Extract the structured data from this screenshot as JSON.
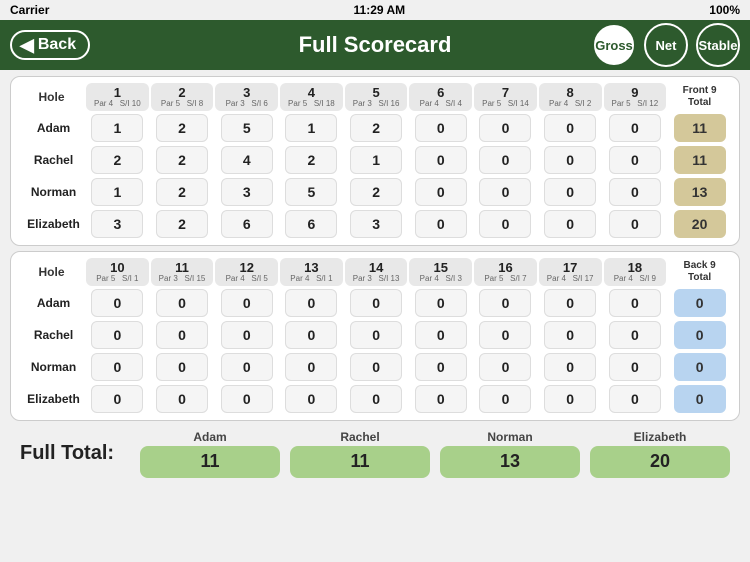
{
  "status_bar": {
    "carrier": "Carrier",
    "time": "11:29 AM",
    "battery": "100%"
  },
  "header": {
    "back_label": "Back",
    "title": "Full Scorecard",
    "modes": [
      {
        "label": "Gross",
        "active": true
      },
      {
        "label": "Net",
        "active": false
      },
      {
        "label": "Stable",
        "active": false
      }
    ]
  },
  "front9": {
    "section_label": "Front 9",
    "holes": [
      {
        "num": "1",
        "par": "4",
        "si": "10"
      },
      {
        "num": "2",
        "par": "5",
        "si": "8"
      },
      {
        "num": "3",
        "par": "3",
        "si": "6"
      },
      {
        "num": "4",
        "par": "5",
        "si": "18"
      },
      {
        "num": "5",
        "par": "3",
        "si": "16"
      },
      {
        "num": "6",
        "par": "4",
        "si": "4"
      },
      {
        "num": "7",
        "par": "5",
        "si": "14"
      },
      {
        "num": "8",
        "par": "4",
        "si": "2"
      },
      {
        "num": "9",
        "par": "5",
        "si": "12"
      }
    ],
    "total_label": "Front 9\nTotal",
    "players": [
      {
        "name": "Adam",
        "scores": [
          "1",
          "2",
          "5",
          "1",
          "2",
          "0",
          "0",
          "0",
          "0"
        ],
        "total": "11"
      },
      {
        "name": "Rachel",
        "scores": [
          "2",
          "2",
          "4",
          "2",
          "1",
          "0",
          "0",
          "0",
          "0"
        ],
        "total": "11"
      },
      {
        "name": "Norman",
        "scores": [
          "1",
          "2",
          "3",
          "5",
          "2",
          "0",
          "0",
          "0",
          "0"
        ],
        "total": "13"
      },
      {
        "name": "Elizabeth",
        "scores": [
          "3",
          "2",
          "6",
          "6",
          "3",
          "0",
          "0",
          "0",
          "0"
        ],
        "total": "20"
      }
    ]
  },
  "back9": {
    "section_label": "Back 9",
    "holes": [
      {
        "num": "10",
        "par": "5",
        "si": "1"
      },
      {
        "num": "11",
        "par": "3",
        "si": "15"
      },
      {
        "num": "12",
        "par": "4",
        "si": "5"
      },
      {
        "num": "13",
        "par": "4",
        "si": "1"
      },
      {
        "num": "14",
        "par": "3",
        "si": "13"
      },
      {
        "num": "15",
        "par": "4",
        "si": "3"
      },
      {
        "num": "16",
        "par": "5",
        "si": "7"
      },
      {
        "num": "17",
        "par": "4",
        "si": "17"
      },
      {
        "num": "18",
        "par": "4",
        "si": "9"
      }
    ],
    "total_label": "Back 9\nTotal",
    "players": [
      {
        "name": "Adam",
        "scores": [
          "0",
          "0",
          "0",
          "0",
          "0",
          "0",
          "0",
          "0",
          "0"
        ],
        "total": "0"
      },
      {
        "name": "Rachel",
        "scores": [
          "0",
          "0",
          "0",
          "0",
          "0",
          "0",
          "0",
          "0",
          "0"
        ],
        "total": "0"
      },
      {
        "name": "Norman",
        "scores": [
          "0",
          "0",
          "0",
          "0",
          "0",
          "0",
          "0",
          "0",
          "0"
        ],
        "total": "0"
      },
      {
        "name": "Elizabeth",
        "scores": [
          "0",
          "0",
          "0",
          "0",
          "0",
          "0",
          "0",
          "0",
          "0"
        ],
        "total": "0"
      }
    ]
  },
  "full_totals": {
    "label": "Full Total:",
    "players": [
      {
        "name": "Adam",
        "score": "11"
      },
      {
        "name": "Rachel",
        "score": "11"
      },
      {
        "name": "Norman",
        "score": "13"
      },
      {
        "name": "Elizabeth",
        "score": "20"
      }
    ]
  }
}
